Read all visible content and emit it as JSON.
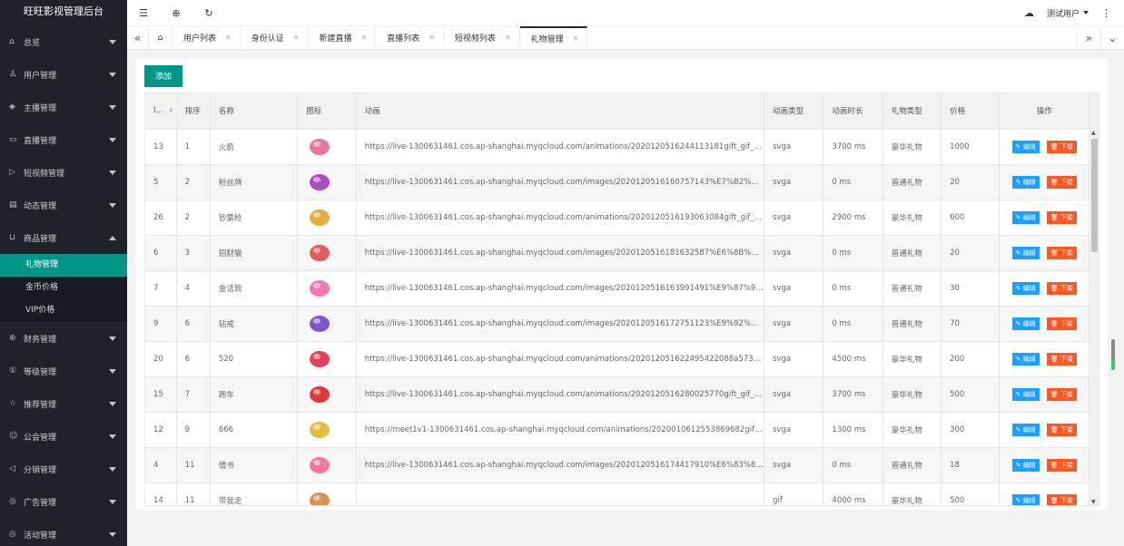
{
  "sidebar": {
    "title": "旺旺影视管理后台",
    "items": [
      {
        "icon": "home-icon",
        "glyph": "⌂",
        "label": "总览",
        "expanded": false
      },
      {
        "icon": "user-icon",
        "glyph": "♙",
        "label": "用户管理",
        "expanded": false
      },
      {
        "icon": "shield-icon",
        "glyph": "◈",
        "label": "主播管理",
        "expanded": false
      },
      {
        "icon": "live-icon",
        "glyph": "▭",
        "label": "直播管理",
        "expanded": false
      },
      {
        "icon": "play-icon",
        "glyph": "▷",
        "label": "短视频管理",
        "expanded": false
      },
      {
        "icon": "dynamic-icon",
        "glyph": "▤",
        "label": "动态管理",
        "expanded": false
      },
      {
        "icon": "cart-icon",
        "glyph": "⊔",
        "label": "商品管理",
        "expanded": true,
        "children": [
          {
            "label": "礼物管理",
            "active": true
          },
          {
            "label": "金币价格",
            "active": false
          },
          {
            "label": "VIP价格",
            "active": false
          }
        ]
      },
      {
        "icon": "finance-icon",
        "glyph": "⊛",
        "label": "财务管理",
        "expanded": false
      },
      {
        "icon": "level-icon",
        "glyph": "①",
        "label": "等级管理",
        "expanded": false
      },
      {
        "icon": "star-icon",
        "glyph": "☆",
        "label": "推荐管理",
        "expanded": false
      },
      {
        "icon": "guild-icon",
        "glyph": "☺",
        "label": "公会管理",
        "expanded": false
      },
      {
        "icon": "distribution-icon",
        "glyph": "◁",
        "label": "分销管理",
        "expanded": false
      },
      {
        "icon": "ad-icon",
        "glyph": "◎",
        "label": "广告管理",
        "expanded": false
      },
      {
        "icon": "activity-icon",
        "glyph": "◎",
        "label": "活动管理",
        "expanded": false
      }
    ]
  },
  "topbar": {
    "user_name": "测试用户"
  },
  "tabs": [
    {
      "label": "用户列表",
      "active": false
    },
    {
      "label": "身份认证",
      "active": false
    },
    {
      "label": "新建直播",
      "active": false
    },
    {
      "label": "直播列表",
      "active": false
    },
    {
      "label": "短视频列表",
      "active": false
    },
    {
      "label": "礼物管理",
      "active": true
    }
  ],
  "main": {
    "add_label": "添加",
    "columns": [
      "I...",
      "排序",
      "名称",
      "图标",
      "动画",
      "动画类型",
      "动画时长",
      "礼物类型",
      "价格",
      "操作"
    ],
    "edit_label": "编辑",
    "off_label": "下架",
    "rows": [
      {
        "id": "13",
        "sort": "1",
        "name": "火箭",
        "icon": "rocket-gift-icon",
        "color": "#e0608a",
        "anim": "https://live-1300631461.cos.ap-shanghai.myqcloud.com/animations/20201205162441131​81gift_gif_31.svga",
        "type": "svga",
        "dur": "3700 ms",
        "gtype": "豪华礼物",
        "price": "1000"
      },
      {
        "id": "5",
        "sort": "2",
        "name": "粉丝牌",
        "icon": "fan-badge-gift-icon",
        "color": "#9b2fb8",
        "anim": "https://live-1300631461.cos.ap-shanghai.myqcloud.com/images/20201205161607571​43%E7%B2%89%E4%B8%9D.png",
        "type": "svga",
        "dur": "0 ms",
        "gtype": "普通礼物",
        "price": "20"
      },
      {
        "id": "26",
        "sort": "2",
        "name": "钞票枪",
        "icon": "money-gun-gift-icon",
        "color": "#e0a020",
        "anim": "https://live-1300631461.cos.ap-shanghai.myqcloud.com/animations/20201205161930630​84gift_gif_30.svga",
        "type": "svga",
        "dur": "2900 ms",
        "gtype": "豪华礼物",
        "price": "600"
      },
      {
        "id": "6",
        "sort": "3",
        "name": "招财猫",
        "icon": "lucky-cat-gift-icon",
        "color": "#e04040",
        "anim": "https://live-1300631461.cos.ap-shanghai.myqcloud.com/images/20201205161816325​87%E6%8B%9B%E8%B4%A2.png",
        "type": "svga",
        "dur": "0 ms",
        "gtype": "普通礼物",
        "price": "20"
      },
      {
        "id": "7",
        "sort": "4",
        "name": "金话筒",
        "icon": "microphone-gift-icon",
        "color": "#f05fa0",
        "anim": "https://live-1300631461.cos.ap-shanghai.myqcloud.com/images/20201205161639914​91%E9%87%91%E8%AF%9D.png",
        "type": "svga",
        "dur": "0 ms",
        "gtype": "普通礼物",
        "price": "30"
      },
      {
        "id": "9",
        "sort": "6",
        "name": "钻戒",
        "icon": "ring-gift-icon",
        "color": "#6a3cc0",
        "anim": "https://live-1300631461.cos.ap-shanghai.myqcloud.com/images/20201205161727511​23%E9%92%BB%E6%88%92.png",
        "type": "svga",
        "dur": "0 ms",
        "gtype": "普通礼物",
        "price": "70"
      },
      {
        "id": "20",
        "sort": "6",
        "name": "520",
        "icon": "heart-balloon-gift-icon",
        "color": "#e02040",
        "anim": "https://live-1300631461.cos.ap-shanghai.myqcloud.com/animations/20201205162249542​2088a57385f6.svga",
        "type": "svga",
        "dur": "4500 ms",
        "gtype": "豪华礼物",
        "price": "200"
      },
      {
        "id": "15",
        "sort": "7",
        "name": "跑车",
        "icon": "sports-car-gift-icon",
        "color": "#d81818",
        "anim": "https://live-1300631461.cos.ap-shanghai.myqcloud.com/animations/20201205162800257​70gift_gif_7.svga",
        "type": "svga",
        "dur": "3700 ms",
        "gtype": "豪华礼物",
        "price": "500"
      },
      {
        "id": "12",
        "sort": "9",
        "name": "666",
        "icon": "666-gift-icon",
        "color": "#e0b020",
        "anim": "https://meet1v1-1300631461.cos.ap-shanghai.myqcloud.com/animations/20200106125538696​82gift_gif_.svga",
        "type": "svga",
        "dur": "1300 ms",
        "gtype": "豪华礼物",
        "price": "300"
      },
      {
        "id": "4",
        "sort": "11",
        "name": "情书",
        "icon": "love-letter-gift-icon",
        "color": "#f06090",
        "anim": "https://live-1300631461.cos.ap-shanghai.myqcloud.com/images/20201205161744179​10%E6%83%85%E4%B9%A6.png",
        "type": "svga",
        "dur": "0 ms",
        "gtype": "普通礼物",
        "price": "18"
      },
      {
        "id": "14",
        "sort": "11",
        "name": "带我走",
        "icon": "take-me-gift-icon",
        "color": "#d08030",
        "anim": "",
        "type": "gif",
        "dur": "4000 ms",
        "gtype": "豪华礼物",
        "price": "500"
      }
    ]
  }
}
